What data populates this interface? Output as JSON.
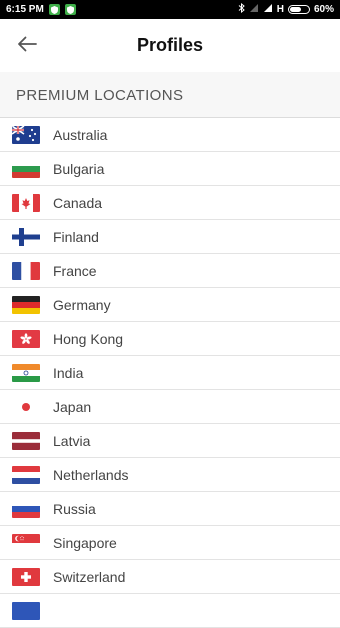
{
  "status_bar": {
    "time": "6:15 PM",
    "network": "H",
    "battery": "60%",
    "battery_level": 0.6
  },
  "header": {
    "title": "Profiles",
    "back_icon": "arrow-left-icon"
  },
  "section": {
    "label": "PREMIUM LOCATIONS"
  },
  "locations": [
    {
      "name": "Australia",
      "flag": "australia-flag-icon"
    },
    {
      "name": "Bulgaria",
      "flag": "bulgaria-flag-icon"
    },
    {
      "name": "Canada",
      "flag": "canada-flag-icon"
    },
    {
      "name": "Finland",
      "flag": "finland-flag-icon"
    },
    {
      "name": "France",
      "flag": "france-flag-icon"
    },
    {
      "name": "Germany",
      "flag": "germany-flag-icon"
    },
    {
      "name": "Hong Kong",
      "flag": "hong-kong-flag-icon"
    },
    {
      "name": "India",
      "flag": "india-flag-icon"
    },
    {
      "name": "Japan",
      "flag": "japan-flag-icon"
    },
    {
      "name": "Latvia",
      "flag": "latvia-flag-icon"
    },
    {
      "name": "Netherlands",
      "flag": "netherlands-flag-icon"
    },
    {
      "name": "Russia",
      "flag": "russia-flag-icon"
    },
    {
      "name": "Singapore",
      "flag": "singapore-flag-icon"
    },
    {
      "name": "Switzerland",
      "flag": "switzerland-flag-icon"
    },
    {
      "name": "",
      "flag": "partial-flag-icon"
    }
  ]
}
